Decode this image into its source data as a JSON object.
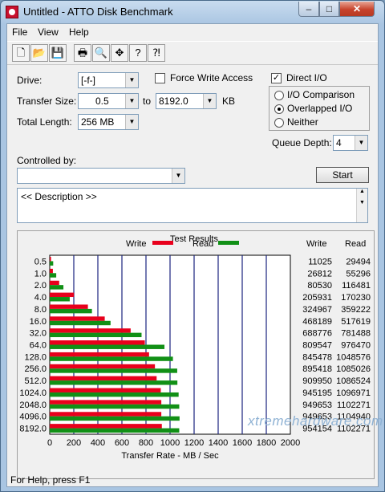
{
  "window": {
    "title": "Untitled - ATTO Disk Benchmark",
    "min": "–",
    "max": "□",
    "close": "✕"
  },
  "menu": [
    "File",
    "View",
    "Help"
  ],
  "toolbar": [
    "new-icon",
    "open-icon",
    "save-icon",
    "print-icon",
    "print-preview-icon",
    "move-icon",
    "help-icon",
    "context-help-icon"
  ],
  "settings": {
    "drive_label": "Drive:",
    "drive_value": "[-f-]",
    "force_write_label": "Force Write Access",
    "force_write_checked": false,
    "direct_io_label": "Direct I/O",
    "direct_io_checked": true,
    "transfer_size_label": "Transfer Size:",
    "transfer_from": "0.5",
    "to_label": "to",
    "transfer_to": "8192.0",
    "kb_label": "KB",
    "total_length_label": "Total Length:",
    "total_length_value": "256 MB",
    "io_comparison_label": "I/O Comparison",
    "overlapped_io_label": "Overlapped I/O",
    "neither_label": "Neither",
    "selected_mode": "Overlapped I/O",
    "queue_depth_label": "Queue Depth:",
    "queue_depth_value": "4",
    "controlled_by_label": "Controlled by:",
    "controlled_by_value": "",
    "start_label": "Start",
    "description": "<< Description >>"
  },
  "results": {
    "title": "Test Results",
    "write_label": "Write",
    "read_label": "Read",
    "write_col": "Write",
    "read_col": "Read",
    "write_color": "#e8001c",
    "read_color": "#119016"
  },
  "chart_data": {
    "type": "bar",
    "orientation": "horizontal",
    "categories": [
      "0.5",
      "1.0",
      "2.0",
      "4.0",
      "8.0",
      "16.0",
      "32.0",
      "64.0",
      "128.0",
      "256.0",
      "512.0",
      "1024.0",
      "2048.0",
      "4096.0",
      "8192.0"
    ],
    "series": [
      {
        "name": "Write",
        "values": [
          11025,
          26812,
          80530,
          205931,
          324967,
          468189,
          688776,
          809547,
          845478,
          895418,
          909950,
          945195,
          949653,
          949653,
          954154
        ]
      },
      {
        "name": "Read",
        "values": [
          29494,
          55296,
          116481,
          170230,
          359222,
          517619,
          781488,
          976470,
          1048576,
          1085026,
          1086524,
          1096971,
          1102271,
          1104940,
          1102271
        ]
      }
    ],
    "xlabel": "Transfer Rate - MB / Sec",
    "xlim": [
      0,
      2000
    ],
    "xticks": [
      "0",
      "200",
      "400",
      "600",
      "800",
      "1000",
      "1200",
      "1400",
      "1600",
      "1800",
      "2000"
    ],
    "grid": true
  },
  "status": {
    "text": "For Help, press F1"
  },
  "watermark": "xtremehardware.com"
}
